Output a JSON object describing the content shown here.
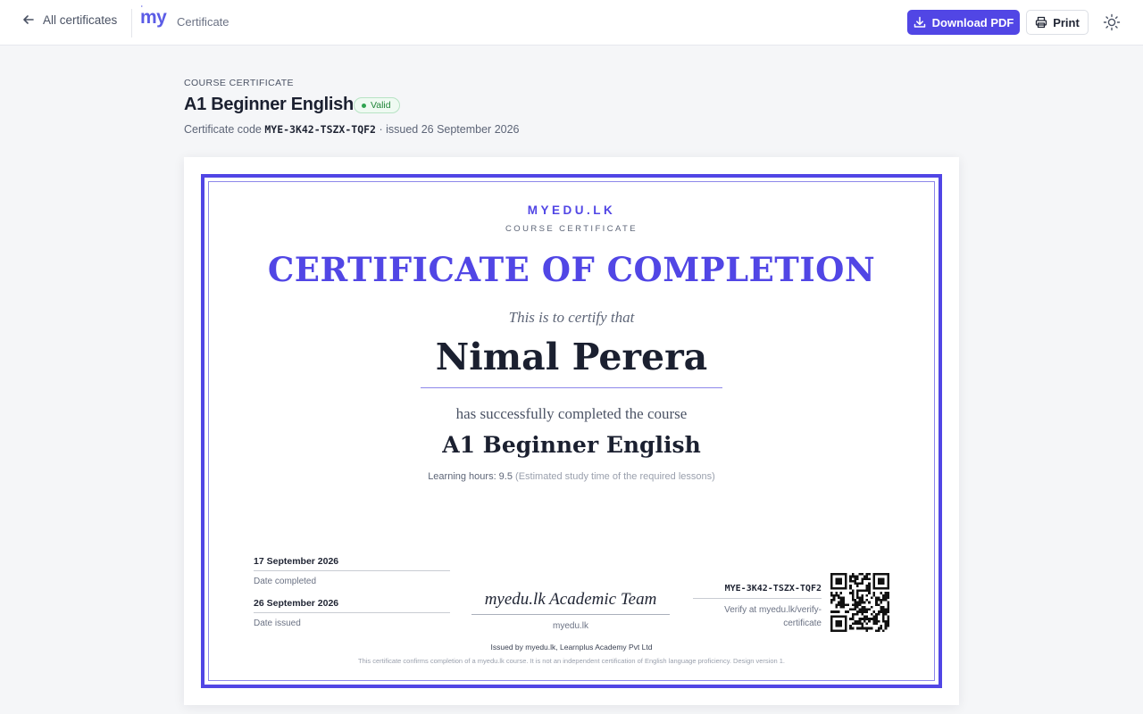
{
  "header": {
    "back_label": "All certificates",
    "logo_text": "my",
    "breadcrumb": "Certificate",
    "download_label": "Download PDF",
    "print_label": "Print",
    "accent_color": "#5146e5"
  },
  "page": {
    "kicker": "COURSE CERTIFICATE",
    "title": "A1 Beginner English",
    "status": "Valid",
    "code_label": "Certificate code",
    "code": "MYE-3K42-TSZX-TQF2",
    "issued_text": "· issued 26 September 2026"
  },
  "certificate": {
    "brand": "MYEDU.LK",
    "brand_sub": "COURSE CERTIFICATE",
    "headline": "CERTIFICATE OF COMPLETION",
    "certify_line": "This is to certify that",
    "recipient": "Nimal Perera",
    "completed_line": "has successfully completed the course",
    "course": "A1 Beginner English",
    "hours_label": "Learning hours: 9.5",
    "hours_note": "(Estimated study time of the required lessons)",
    "date_completed": "17 September 2026",
    "date_completed_label": "Date completed",
    "date_issued": "26 September 2026",
    "date_issued_label": "Date issued",
    "signature": "myedu.lk Academic Team",
    "signature_org": "myedu.lk",
    "verify_code": "MYE-3K42-TSZX-TQF2",
    "verify_text": "Verify at myedu.lk/verify-certificate",
    "issuer": "Issued by myedu.lk, Learnplus Academy Pvt Ltd",
    "disclaimer": "This certificate confirms completion of a myedu.lk course. It is not an independent certification of English language proficiency. Design version 1."
  }
}
